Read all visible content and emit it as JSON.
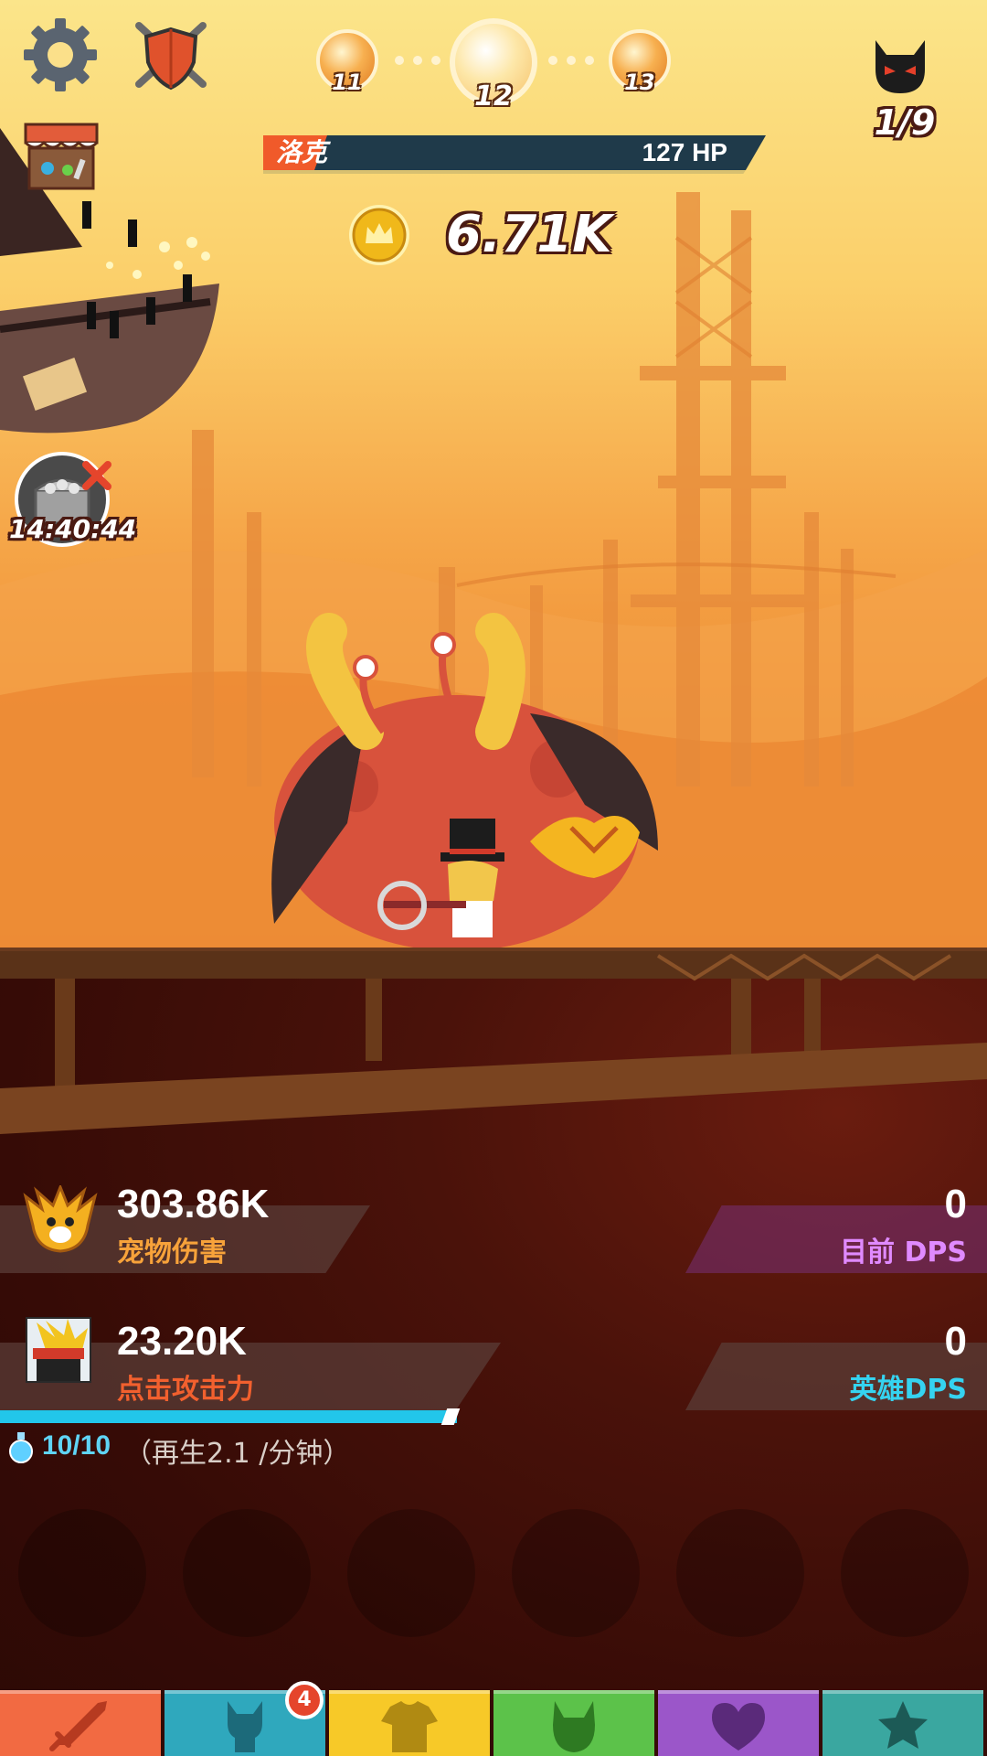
{
  "stage": {
    "prev": "11",
    "current": "12",
    "next": "13"
  },
  "boss": {
    "name": "洛克",
    "hp": "127 HP"
  },
  "gold": "6.71K",
  "kills": "1/9",
  "chest_timer": "14:40:44",
  "pet": {
    "value": "303.86K",
    "label": "宠物伤害"
  },
  "current_dps": {
    "value": "0",
    "label": "目前 DPS"
  },
  "tap": {
    "value": "23.20K",
    "label": "点击攻击力"
  },
  "hero_dps": {
    "value": "0",
    "label": "英雄DPS"
  },
  "mana": {
    "amount": "10/10",
    "regen": "（再生2.1 /分钟）",
    "level": 1.0
  },
  "tabs": [
    {
      "icon": "sword-icon",
      "color": "#f26a42"
    },
    {
      "icon": "heroes-icon",
      "color": "#2fa8bd",
      "badge": "4"
    },
    {
      "icon": "shirt-icon",
      "color": "#f7c928"
    },
    {
      "icon": "pet-icon",
      "color": "#5cc24a"
    },
    {
      "icon": "clan-icon",
      "color": "#9b56c9"
    },
    {
      "icon": "star-icon",
      "color": "#3aa7a0"
    }
  ],
  "colors": {
    "pet_label": "#f7a23a",
    "tap_label": "#f2602e",
    "current_dps_label": "#e08aff",
    "hero_dps_label": "#35d3f0",
    "mana_bar": "#22c6ea"
  }
}
